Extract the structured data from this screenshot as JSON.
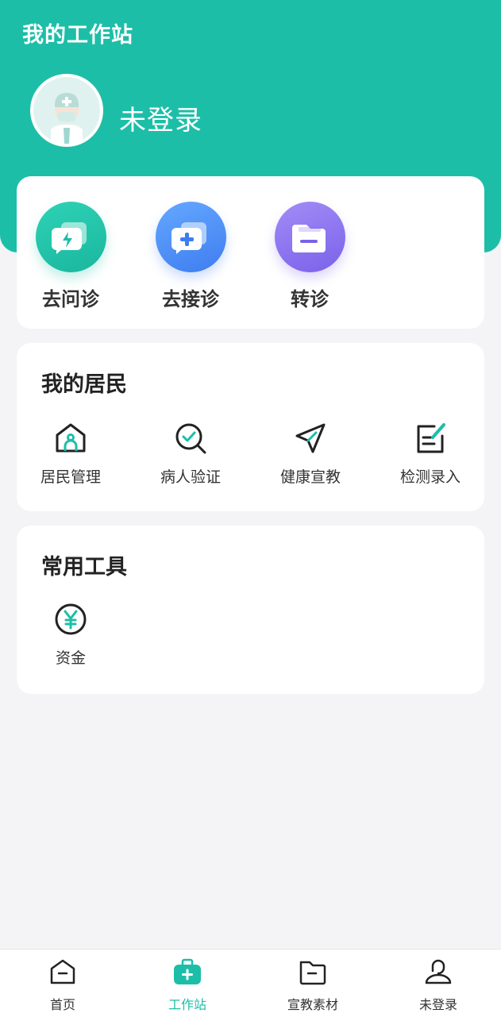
{
  "header": {
    "title": "我的工作站",
    "user_name": "未登录",
    "accent_color": "#1dbea8"
  },
  "quick_actions": [
    {
      "label": "去问诊",
      "icon": "lightning-chat-icon",
      "color": "#1dbea8"
    },
    {
      "label": "去接诊",
      "icon": "plus-chat-icon",
      "color": "#3f7df0"
    },
    {
      "label": "转诊",
      "icon": "folder-transfer-icon",
      "color": "#7a62ea"
    }
  ],
  "residents": {
    "title": "我的居民",
    "items": [
      {
        "label": "居民管理",
        "icon": "house-person-icon"
      },
      {
        "label": "病人验证",
        "icon": "search-check-icon"
      },
      {
        "label": "健康宣教",
        "icon": "send-plane-icon"
      },
      {
        "label": "检测录入",
        "icon": "edit-note-icon"
      }
    ]
  },
  "tools": {
    "title": "常用工具",
    "items": [
      {
        "label": "资金",
        "icon": "yuan-icon"
      }
    ]
  },
  "tabbar": {
    "active": "工作站",
    "items": [
      {
        "label": "首页",
        "icon": "home-icon"
      },
      {
        "label": "工作站",
        "icon": "medkit-icon"
      },
      {
        "label": "宣教素材",
        "icon": "folder-icon"
      },
      {
        "label": "未登录",
        "icon": "user-icon"
      }
    ]
  }
}
